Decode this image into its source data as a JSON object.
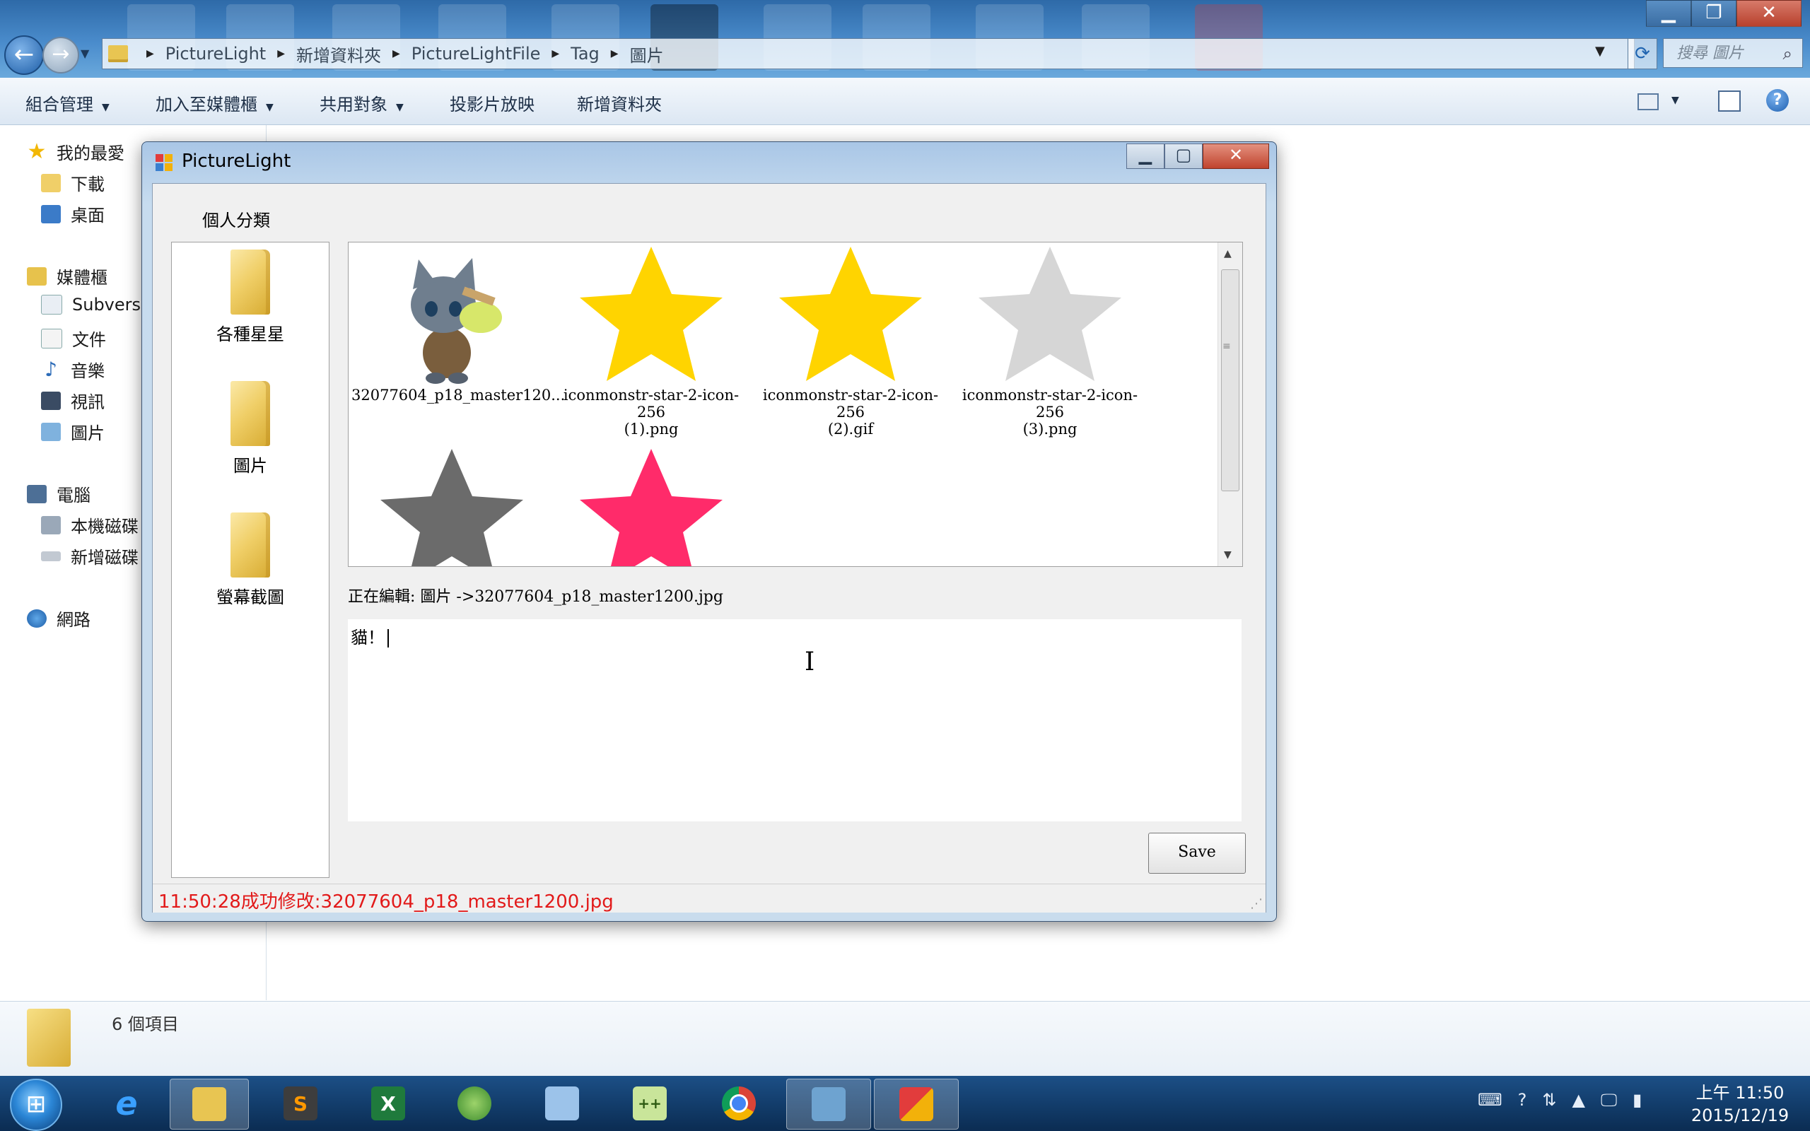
{
  "explorer": {
    "breadcrumbs": [
      "PictureLight",
      "新增資料夾",
      "PictureLightFile",
      "Tag",
      "圖片"
    ],
    "search_placeholder": "搜尋 圖片",
    "toolbar": {
      "organize": "組合管理",
      "add_to_library": "加入至媒體櫃",
      "share_with": "共用對象",
      "slideshow": "投影片放映",
      "new_folder": "新增資料夾"
    },
    "nav": {
      "favorites": "我的最愛",
      "downloads": "下載",
      "desktop": "桌面",
      "libraries": "媒體櫃",
      "subversion": "Subversi",
      "documents": "文件",
      "music": "音樂",
      "videos": "視訊",
      "pictures": "圖片",
      "computer": "電腦",
      "local_disk": "本機磁碟",
      "new_volume": "新增磁碟",
      "network": "網路"
    },
    "details_count": "6 個項目"
  },
  "app": {
    "title": "PictureLight",
    "category_label": "個人分類",
    "folders": [
      "各種星星",
      "圖片",
      "螢幕截圖"
    ],
    "thumbnails": [
      {
        "line1": "32077604_p18_master120...",
        "line2": "",
        "icon": "cat-character-image"
      },
      {
        "line1": "iconmonstr-star-2-icon-256",
        "line2": "(1).png",
        "color": "#ffd400"
      },
      {
        "line1": "iconmonstr-star-2-icon-256",
        "line2": "(2).gif",
        "color": "#ffd400"
      },
      {
        "line1": "iconmonstr-star-2-icon-256",
        "line2": "(3).png",
        "color": "#d6d6d6"
      },
      {
        "line1": "",
        "line2": "",
        "color": "#6b6b6b"
      },
      {
        "line1": "",
        "line2": "",
        "color": "#ff2b6a"
      }
    ],
    "editing_label": "正在編輯: 圖片 ->32077604_p18_master1200.jpg",
    "note_text": "貓！",
    "save_label": "Save",
    "status_text": "11:50:28成功修改:32077604_p18_master1200.jpg",
    "status_color": "#e21a1a"
  },
  "taskbar": {
    "pinned": [
      "internet-explorer-icon",
      "file-explorer-icon",
      "sublime-text-icon",
      "excel-icon",
      "paint-icon",
      "notepad-icon",
      "notepad-plus-plus-icon",
      "chrome-icon",
      "photo-viewer-icon",
      "picturelight-app-icon"
    ],
    "clock_time": "上午 11:50",
    "clock_date": "2015/12/19"
  }
}
